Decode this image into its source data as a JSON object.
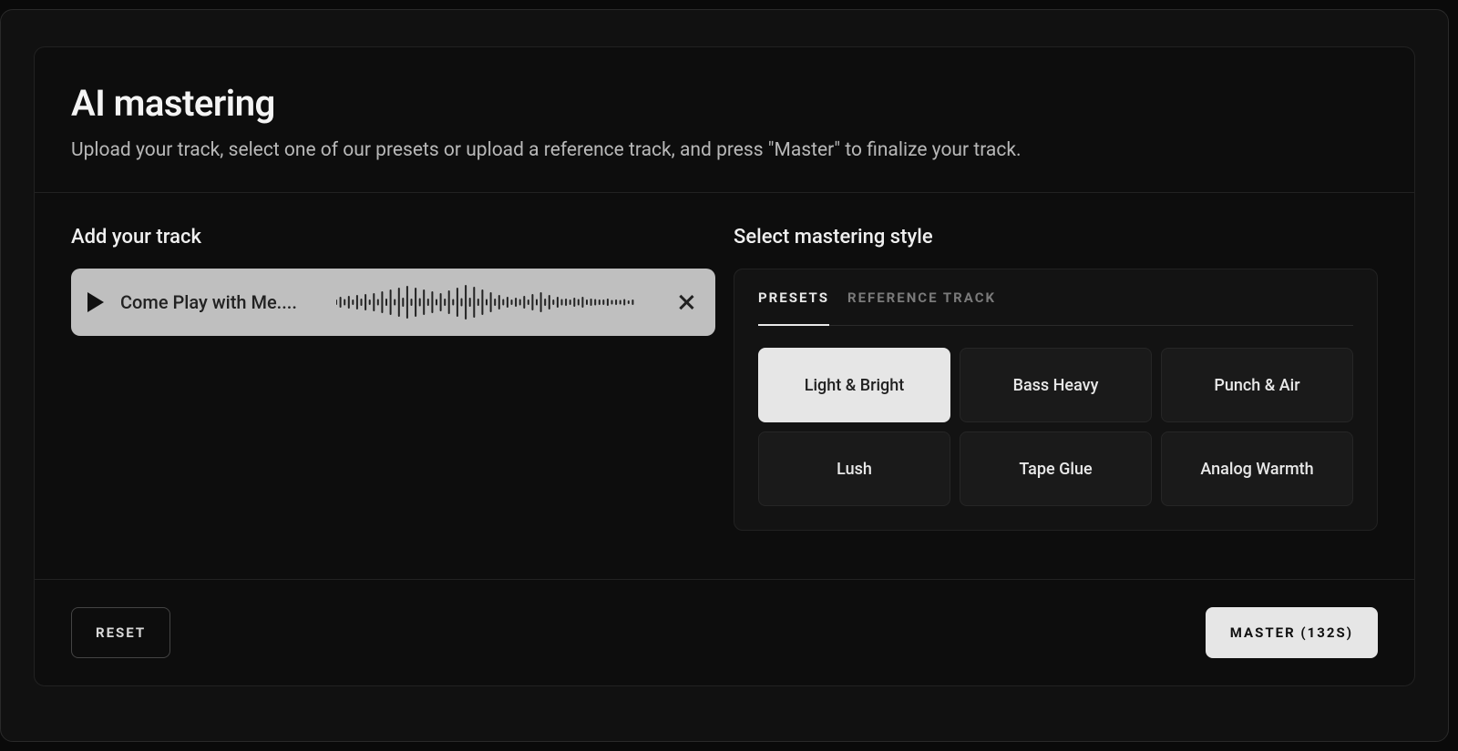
{
  "header": {
    "title": "AI mastering",
    "subtitle": "Upload your track, select one of our presets or upload a reference track, and press \"Master\" to finalize your track."
  },
  "left": {
    "label": "Add your track",
    "track_name": "Come Play with Me...."
  },
  "right": {
    "label": "Select mastering style",
    "tabs": {
      "presets": "PRESETS",
      "reference": "REFERENCE TRACK"
    },
    "presets": {
      "light_bright": "Light & Bright",
      "bass_heavy": "Bass Heavy",
      "punch_air": "Punch & Air",
      "lush": "Lush",
      "tape_glue": "Tape Glue",
      "analog_warmth": "Analog Warmth"
    }
  },
  "footer": {
    "reset": "RESET",
    "master": "MASTER (132S)"
  },
  "waveform_heights": [
    4,
    10,
    5,
    12,
    4,
    14,
    6,
    16,
    4,
    18,
    5,
    22,
    6,
    26,
    5,
    30,
    8,
    34,
    6,
    30,
    7,
    26,
    6,
    22,
    5,
    18,
    6,
    24,
    5,
    30,
    7,
    36,
    8,
    32,
    6,
    26,
    5,
    20,
    6,
    14,
    5,
    10,
    4,
    8,
    5,
    12,
    4,
    16,
    5,
    20,
    6,
    14,
    4,
    10,
    5,
    6,
    4,
    8,
    5,
    10,
    4,
    6,
    5,
    4,
    4,
    6,
    3,
    4,
    3,
    5,
    2,
    4
  ]
}
